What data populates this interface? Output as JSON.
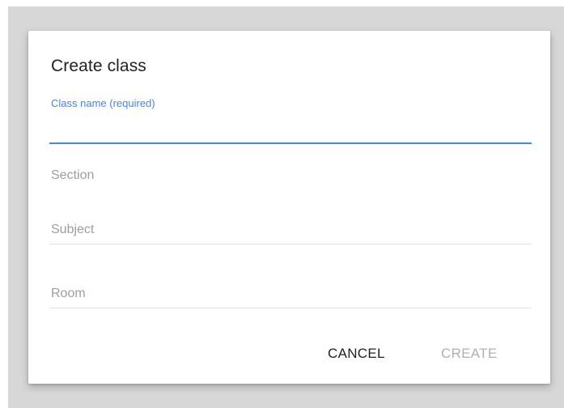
{
  "dialog": {
    "title": "Create class",
    "fields": {
      "class_name": {
        "label": "Class name (required)",
        "value": ""
      },
      "section": {
        "label": "Section",
        "value": ""
      },
      "subject": {
        "label": "Subject",
        "value": ""
      },
      "room": {
        "label": "Room",
        "value": ""
      }
    },
    "buttons": {
      "cancel": "CANCEL",
      "create": "CREATE"
    }
  },
  "colors": {
    "accent": "#4285f4",
    "disabled_text": "#b0b0b0",
    "backdrop": "#d7d7d7"
  }
}
